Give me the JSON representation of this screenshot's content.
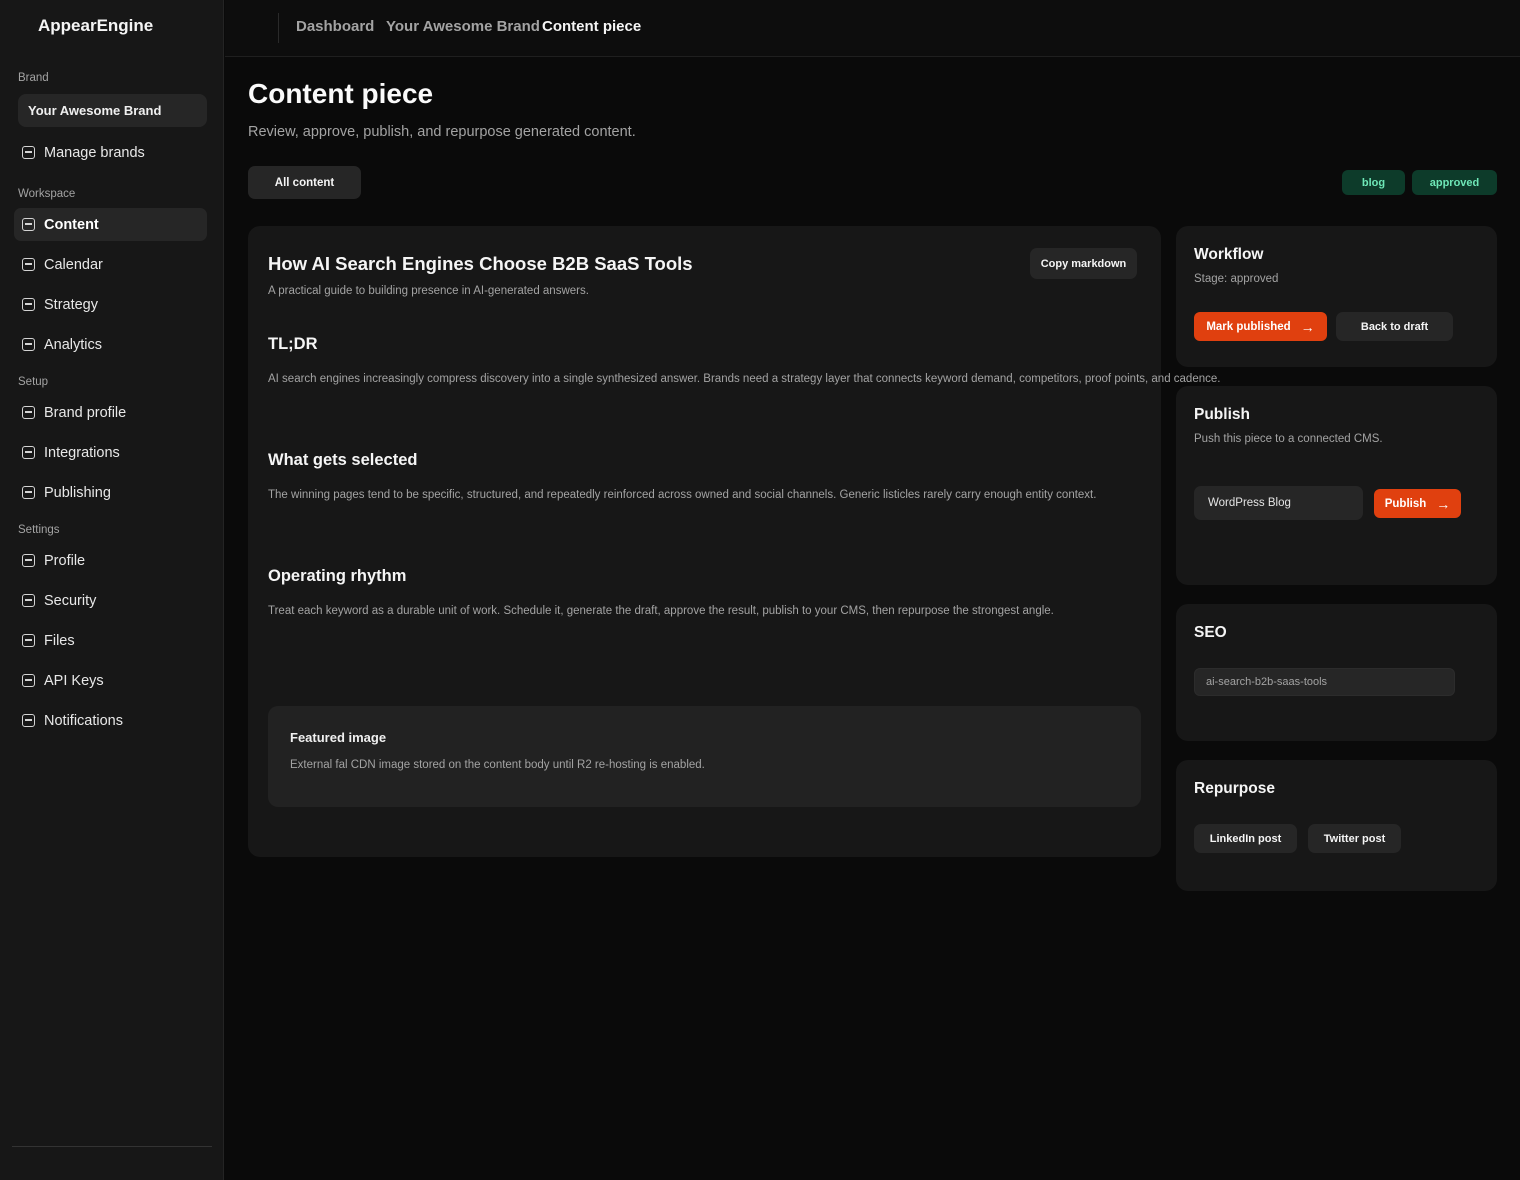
{
  "app": {
    "name": "AppearEngine"
  },
  "sidebar": {
    "sections": {
      "brand": "Brand",
      "workspace": "Workspace",
      "setup": "Setup",
      "settings": "Settings"
    },
    "brand_selected": "Your Awesome Brand",
    "items": {
      "manage_brands": "Manage brands",
      "content": "Content",
      "calendar": "Calendar",
      "strategy": "Strategy",
      "analytics": "Analytics",
      "brand_profile": "Brand profile",
      "integrations": "Integrations",
      "publishing": "Publishing",
      "profile": "Profile",
      "security": "Security",
      "files": "Files",
      "api_keys": "API Keys",
      "notifications": "Notifications"
    }
  },
  "breadcrumb": [
    "Dashboard",
    "Your Awesome Brand",
    "Content piece"
  ],
  "page": {
    "title": "Content piece",
    "subtitle": "Review, approve, publish, and repurpose generated content.",
    "all_content_label": "All content",
    "badges": [
      "blog",
      "approved"
    ]
  },
  "article": {
    "title": "How AI Search Engines Choose B2B SaaS Tools",
    "subtitle": "A practical guide to building presence in AI-generated answers.",
    "copy_label": "Copy markdown",
    "sections": [
      {
        "heading": "TL;DR",
        "body": "AI search engines increasingly compress discovery into a single synthesized answer. Brands need a strategy layer that connects keyword demand, competitors, proof points, and cadence."
      },
      {
        "heading": "What gets selected",
        "body": "The winning pages tend to be specific, structured, and repeatedly reinforced across owned and social channels. Generic listicles rarely carry enough entity context."
      },
      {
        "heading": "Operating rhythm",
        "body": "Treat each keyword as a durable unit of work. Schedule it, generate the draft, approve the result, publish to your CMS, then repurpose the strongest angle."
      }
    ],
    "featured": {
      "title": "Featured image",
      "text": "External fal CDN image stored on the content body until R2 re-hosting is enabled."
    }
  },
  "workflow": {
    "title": "Workflow",
    "stage": "Stage: approved",
    "mark_published": "Mark published",
    "back_to_draft": "Back to draft"
  },
  "publish": {
    "title": "Publish",
    "text": "Push this piece to a connected CMS.",
    "target": "WordPress Blog",
    "button": "Publish"
  },
  "seo": {
    "title": "SEO",
    "slug": "ai-search-b2b-saas-tools"
  },
  "repurpose": {
    "title": "Repurpose",
    "linkedin": "LinkedIn post",
    "twitter": "Twitter post"
  },
  "colors": {
    "accent": "#e0400f",
    "badge_bg": "#0d3b2a",
    "badge_text": "#6ee7b7",
    "background": "#0a0a0a",
    "panel": "#171717"
  }
}
